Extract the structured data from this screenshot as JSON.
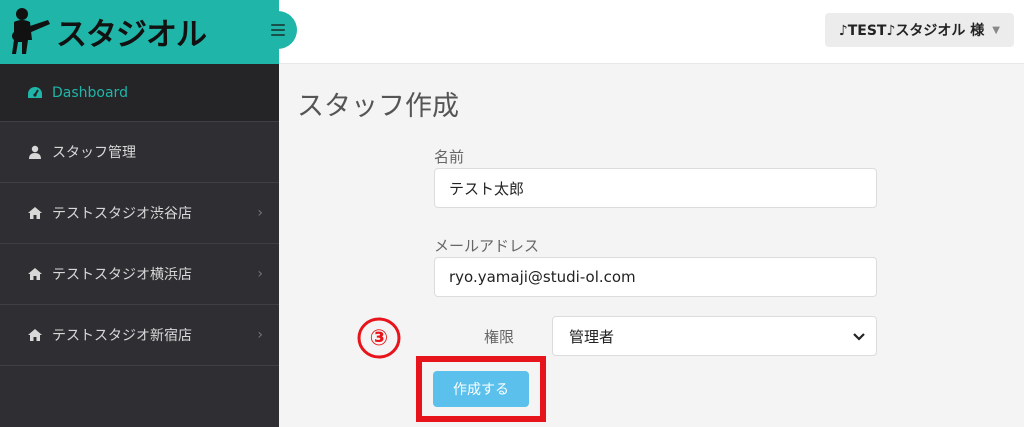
{
  "brand": {
    "logo_text": "スタジオル"
  },
  "header": {
    "user_label": "♪TEST♪スタジオル 様"
  },
  "sidebar": {
    "items": [
      {
        "label": "Dashboard",
        "icon": "dashboard-icon",
        "active": true
      },
      {
        "label": "スタッフ管理",
        "icon": "user-icon"
      },
      {
        "label": "テストスタジオ渋谷店",
        "icon": "home-icon",
        "chevron": true
      },
      {
        "label": "テストスタジオ横浜店",
        "icon": "home-icon",
        "chevron": true
      },
      {
        "label": "テストスタジオ新宿店",
        "icon": "home-icon",
        "chevron": true
      }
    ]
  },
  "main": {
    "title": "スタッフ作成",
    "name_label": "名前",
    "name_value": "テスト太郎",
    "email_label": "メールアドレス",
    "email_value": "ryo.yamaji@studi-ol.com",
    "role_label": "権限",
    "role_value": "管理者",
    "submit_label": "作成する"
  },
  "annotation": {
    "number": "③",
    "color": "#e8141b"
  },
  "colors": {
    "accent": "#1fb5a8",
    "button": "#5bc0eb",
    "sidebar": "#2f2f33"
  }
}
